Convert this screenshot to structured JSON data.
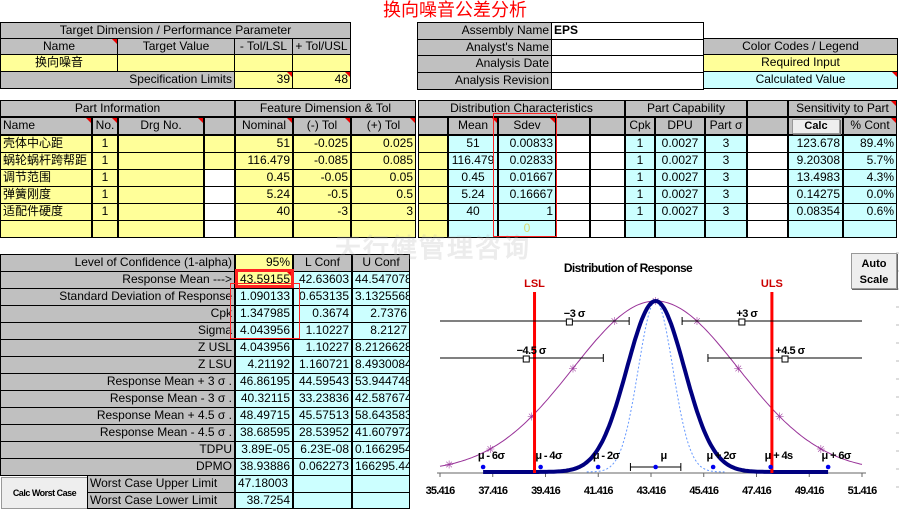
{
  "title": "换向噪音公差分析",
  "watermark": "天行健管理咨询",
  "colors": {
    "header_gray": "#c0c0c0",
    "required_input": "#ffff99",
    "calculated_value": "#ccffff",
    "highlight": "#ff2222"
  },
  "target": {
    "header": "Target Dimension / Performance Parameter",
    "col_name": "Name",
    "col_target": "Target Value",
    "col_minus": "- Tol/LSL",
    "col_plus": "+ Tol/USL",
    "name_value": "换向噪音",
    "target_value": "",
    "spec_label": "Specification Limits",
    "lsl": "39",
    "usl": "48"
  },
  "assembly": {
    "assembly_label": "Assembly Name",
    "assembly_value": "EPS",
    "analyst_label": "Analyst's Name",
    "analyst_value": "",
    "date_label": "Analysis Date",
    "date_value": "",
    "revision_label": "Analysis Revision",
    "revision_value": ""
  },
  "legend": {
    "title": "Color Codes / Legend",
    "required": "Required Input",
    "calculated": "Calculated Value"
  },
  "parts": {
    "groups": {
      "part_info": "Part Information",
      "feature": "Feature Dimension & Tol",
      "distribution": "Distribution Characteristics",
      "capability": "Part Capability",
      "sensitivity": "Sensitivity to Part"
    },
    "columns": {
      "name": "Name",
      "no": "No.",
      "drg": "Drg No.",
      "nominal": "Nominal",
      "minus_tol": "(-) Tol",
      "plus_tol": "(+) Tol",
      "mean": "Mean",
      "sdev": "Sdev",
      "cpk": "Cpk",
      "dpu": "DPU",
      "part_sigma": "Part σ",
      "calc_button": "Calc",
      "cont": "% Cont"
    },
    "rows": [
      {
        "name": "壳体中心距",
        "no": "1",
        "nominal": "51",
        "minus": "-0.025",
        "plus": "0.025",
        "mean": "51",
        "sdev": "0.00833",
        "cpk": "1",
        "dpu": "0.0027",
        "part_sigma": "3",
        "sensitivity": "123.678",
        "cont": "89.4%"
      },
      {
        "name": "蜗轮蜗杆跨帮距",
        "no": "1",
        "nominal": "116.479",
        "minus": "-0.085",
        "plus": "0.085",
        "mean": "116.479",
        "sdev": "0.02833",
        "cpk": "1",
        "dpu": "0.0027",
        "part_sigma": "3",
        "sensitivity": "9.20308",
        "cont": "5.7%"
      },
      {
        "name": "调节范围",
        "no": "1",
        "nominal": "0.45",
        "minus": "-0.05",
        "plus": "0.05",
        "mean": "0.45",
        "sdev": "0.01667",
        "cpk": "1",
        "dpu": "0.0027",
        "part_sigma": "3",
        "sensitivity": "13.4983",
        "cont": "4.3%"
      },
      {
        "name": "弹簧刚度",
        "no": "1",
        "nominal": "5.24",
        "minus": "-0.5",
        "plus": "0.5",
        "mean": "5.24",
        "sdev": "0.16667",
        "cpk": "1",
        "dpu": "0.0027",
        "part_sigma": "3",
        "sensitivity": "0.14275",
        "cont": "0.0%"
      },
      {
        "name": "适配件硬度",
        "no": "1",
        "nominal": "40",
        "minus": "-3",
        "plus": "3",
        "mean": "40",
        "sdev": "1",
        "cpk": "1",
        "dpu": "0.0027",
        "part_sigma": "3",
        "sensitivity": "0.08354",
        "cont": "0.6%"
      },
      {
        "name": "",
        "no": "",
        "nominal": "",
        "minus": "",
        "plus": "",
        "mean": "",
        "sdev": "0",
        "cpk": "",
        "dpu": "",
        "part_sigma": "",
        "sensitivity": "",
        "cont": ""
      }
    ]
  },
  "results": {
    "confidence_label": "Level of Confidence (1-alpha)",
    "confidence": "95%",
    "lconf_label": "L Conf",
    "uconf_label": "U Conf",
    "rows": [
      {
        "label": "Response Mean --->",
        "value": "43.59155",
        "l": "42.63603",
        "u": "44.547078"
      },
      {
        "label": "Standard Deviation of Response",
        "value": "1.090133",
        "l": "0.653135",
        "u": "3.1325568"
      },
      {
        "label": "Cpk",
        "value": "1.347985",
        "l": "0.3674",
        "u": "2.7376"
      },
      {
        "label": "Sigma",
        "value": "4.043956",
        "l": "1.10227",
        "u": "8.2127"
      },
      {
        "label": "Z USL",
        "value": "4.043956",
        "l": "1.10227",
        "u": "8.2126628"
      },
      {
        "label": "Z LSU",
        "value": "4.21192",
        "l": "1.160721",
        "u": "8.4930084"
      },
      {
        "label": "Response Mean + 3 σ .",
        "value": "46.86195",
        "l": "44.59543",
        "u": "53.944748"
      },
      {
        "label": "Response Mean - 3 σ .",
        "value": "40.32115",
        "l": "33.23836",
        "u": "42.587674"
      },
      {
        "label": "Response Mean + 4.5 σ .",
        "value": "48.49715",
        "l": "45.57513",
        "u": "58.643583"
      },
      {
        "label": "Response Mean - 4.5 σ .",
        "value": "38.68595",
        "l": "28.53952",
        "u": "41.607972"
      },
      {
        "label": "TDPU",
        "value": "3.89E-05",
        "l": "6.23E-08",
        "u": "0.1662954"
      },
      {
        "label": "DPMO",
        "value": "38.93886",
        "l": "0.062273",
        "u": "166295.44"
      }
    ],
    "worst_case": {
      "button": "Calc Worst Case",
      "upper_label": "Worst Case Upper Limit",
      "upper": "47.18003",
      "lower_label": "Worst Case Lower Limit",
      "lower": "38.7254"
    }
  },
  "chart_data": {
    "type": "line",
    "title": "Distribution of Response",
    "auto_scale_button": "Auto Scale",
    "xlim": [
      35.416,
      51.416
    ],
    "x_ticks": [
      "35.416",
      "37.416",
      "39.416",
      "41.416",
      "43.416",
      "45.416",
      "47.416",
      "49.416",
      "51.416"
    ],
    "mean": 43.59155,
    "sdev": 1.090133,
    "sdev_lower": 0.653135,
    "sdev_upper": 3.1325568,
    "mean_conf": [
      42.63603,
      44.547078
    ],
    "lsl": 39,
    "usl": 48,
    "lsl_label": "LSL",
    "usl_label": "ULS",
    "sigma_intervals": [
      {
        "label": "−3 σ",
        "value": 40.32115,
        "conf": [
          33.23836,
          42.587674
        ]
      },
      {
        "label": "+3 σ",
        "value": 46.86195,
        "conf": [
          44.59543,
          53.944748
        ]
      },
      {
        "label": "−4.5 σ",
        "value": 38.68595,
        "conf": [
          28.53952,
          41.607972
        ]
      },
      {
        "label": "+4.5 σ",
        "value": 48.49715,
        "conf": [
          45.57513,
          58.643583
        ]
      }
    ],
    "sigma_markers": [
      {
        "label": "μ - 6σ",
        "k": -6
      },
      {
        "label": "μ - 4σ",
        "k": -4
      },
      {
        "label": "μ - 2σ",
        "k": -2
      },
      {
        "label": "μ",
        "k": 0
      },
      {
        "label": "μ + 2σ",
        "k": 2
      },
      {
        "label": "μ + 4s",
        "k": 4
      },
      {
        "label": "μ + 6σ",
        "k": 6
      }
    ],
    "series_colors": {
      "response": "#000080",
      "lower": "#6699ff",
      "upper": "#993399",
      "limits": "#ff0000"
    }
  }
}
